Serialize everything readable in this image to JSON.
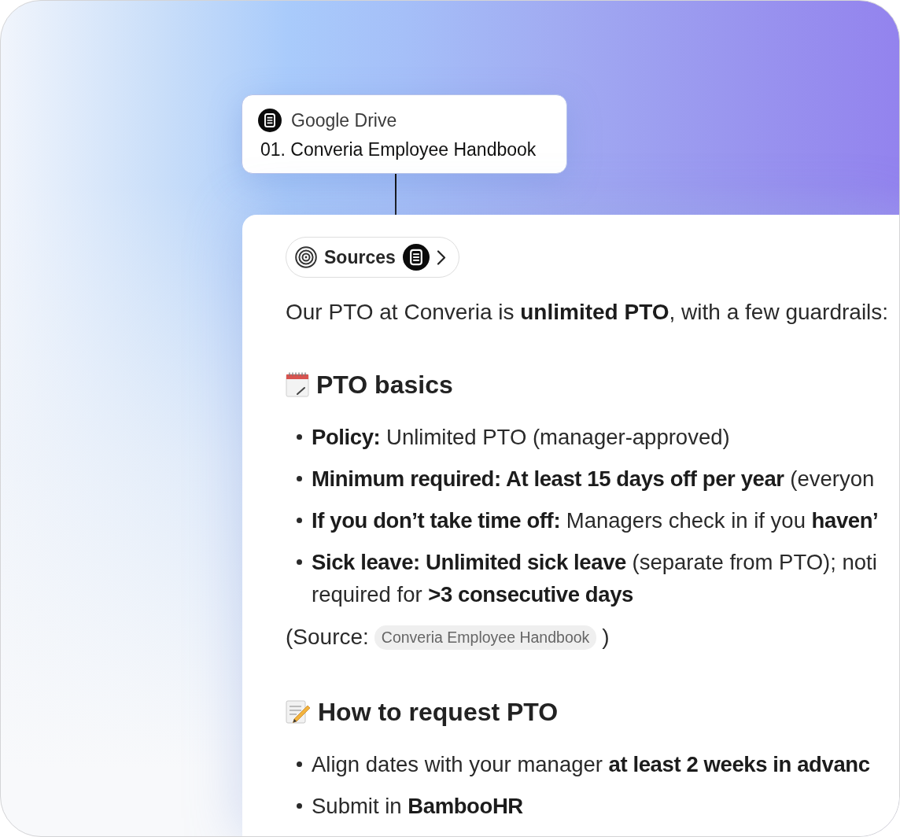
{
  "source_card": {
    "app": "Google Drive",
    "title": "01. Converia Employee Handbook"
  },
  "answer": {
    "sources_button": {
      "label": "Sources"
    },
    "intro": "Our PTO at Converia is **unlimited PTO**, with a few guardrails:",
    "sections": [
      {
        "heading": "PTO basics",
        "items": [
          {
            "lines": [
              "**Policy:** Unlimited PTO (manager-approved)"
            ]
          },
          {
            "lines": [
              "**Minimum required: At least 15 days off per year** (everyon"
            ]
          },
          {
            "lines": [
              "**If you don’t take time off:** Managers check in if you **haven’**"
            ]
          },
          {
            "lines": [
              "**Sick leave: Unlimited sick leave** (separate from PTO); noti",
              "required for **>3 consecutive days**"
            ]
          }
        ],
        "citation": {
          "prefix": "(Source:",
          "chip": "Converia Employee Handbook",
          "suffix": ")"
        }
      },
      {
        "heading": "How to request PTO",
        "items": [
          {
            "lines": [
              "Align dates with your manager **at least 2 weeks in advanc**"
            ]
          },
          {
            "lines": [
              "Submit in **BambooHR**"
            ]
          }
        ]
      }
    ]
  }
}
